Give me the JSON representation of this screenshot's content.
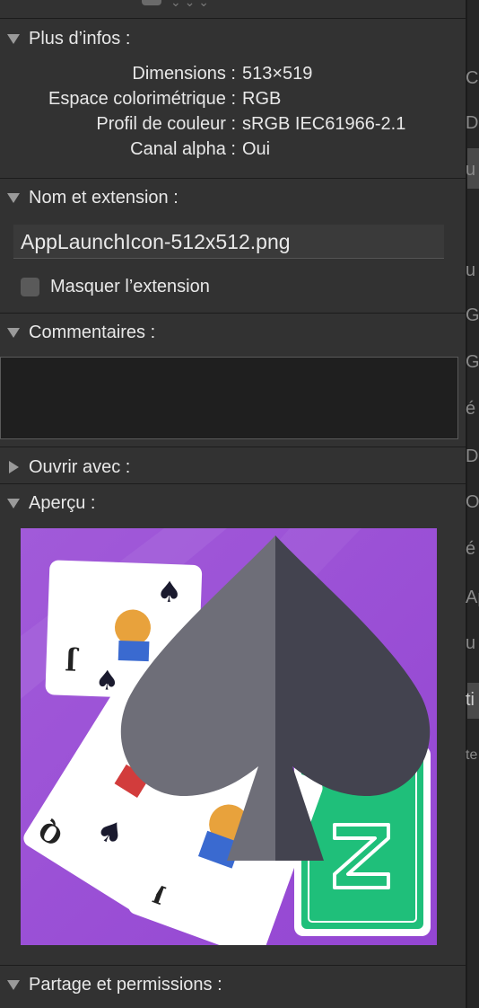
{
  "sections": {
    "more_info": "Plus d’infos :",
    "name_ext": "Nom et extension :",
    "comments": "Commentaires :",
    "open_with": "Ouvrir avec :",
    "preview": "Aperçu :",
    "sharing": "Partage et permissions :"
  },
  "info": {
    "dimensions_label": "Dimensions :",
    "dimensions_value": "513×519",
    "colorspace_label": "Espace colorimétrique :",
    "colorspace_value": "RGB",
    "profile_label": "Profil de couleur :",
    "profile_value": "sRGB IEC61966-2.1",
    "alpha_label": "Canal alpha :",
    "alpha_value": "Oui"
  },
  "filename": "AppLaunchIcon-512x512.png",
  "hide_extension_label": "Masquer l’extension",
  "hide_extension_checked": false,
  "comments_value": "",
  "background_fragments": [
    "Cl",
    "Dc",
    "u",
    "u",
    "Gc",
    "Gr",
    "é",
    "Da",
    "Or",
    "é",
    "Ap",
    "u",
    "ti",
    "te"
  ],
  "colors": {
    "panel": "#323232",
    "preview_purple": "#9b4fd6",
    "spade_light": "#6e6e78",
    "spade_dark": "#43434f",
    "card_green": "#1fbf7a"
  }
}
